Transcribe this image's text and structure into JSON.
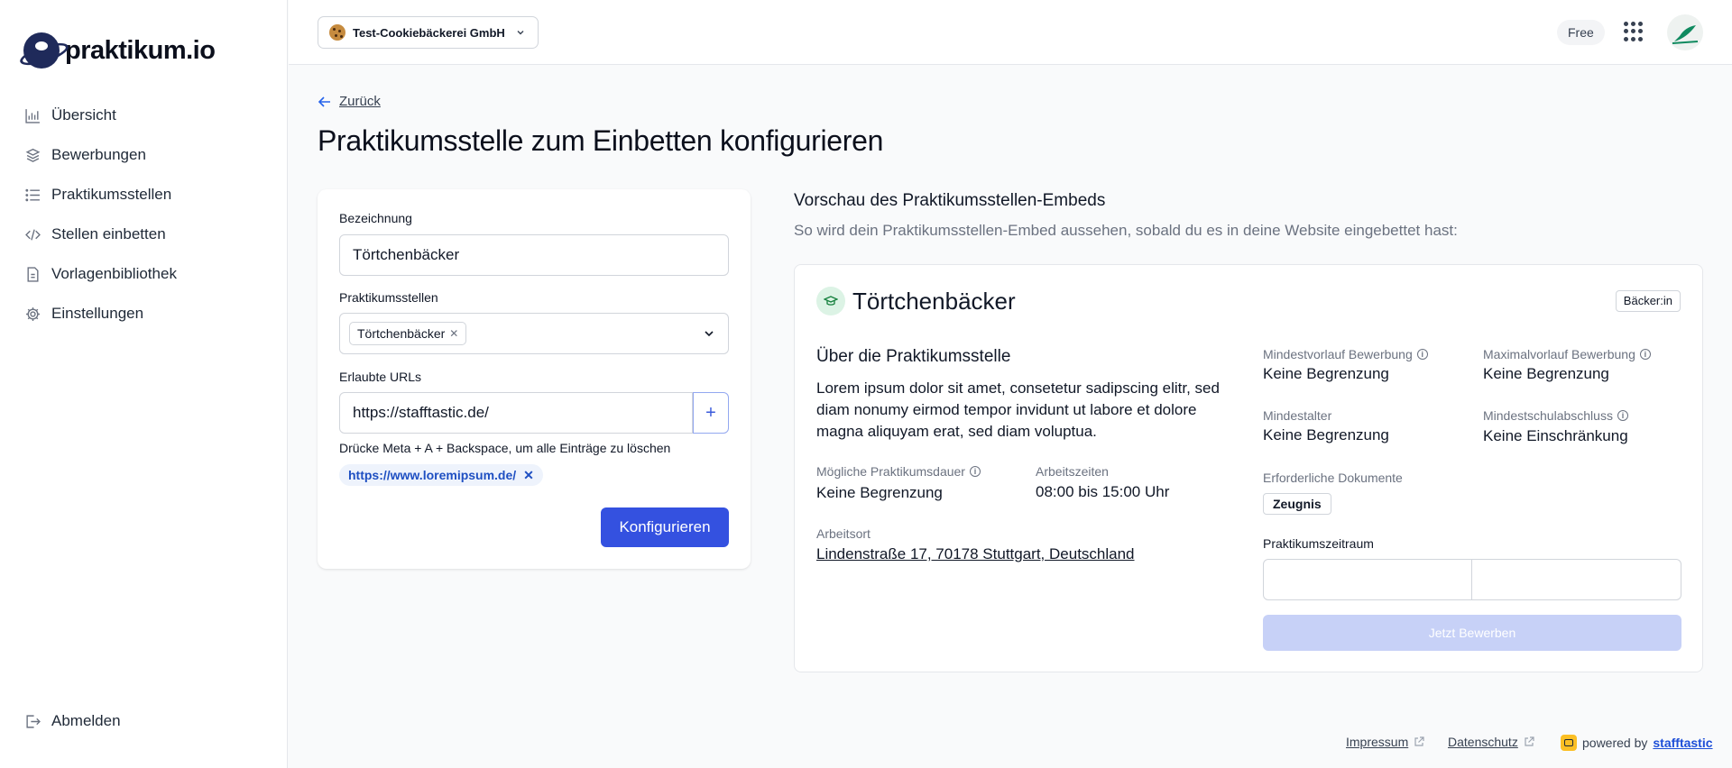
{
  "app": {
    "logo_text": "praktikum.io"
  },
  "sidebar": {
    "items": [
      {
        "label": "Übersicht",
        "icon": "bar-chart-icon"
      },
      {
        "label": "Bewerbungen",
        "icon": "layers-icon"
      },
      {
        "label": "Praktikumsstellen",
        "icon": "list-icon"
      },
      {
        "label": "Stellen einbetten",
        "icon": "code-icon"
      },
      {
        "label": "Vorlagenbibliothek",
        "icon": "file-icon"
      },
      {
        "label": "Einstellungen",
        "icon": "gear-icon"
      }
    ],
    "logout_label": "Abmelden"
  },
  "topbar": {
    "company": "Test-Cookiebäckerei GmbH",
    "plan": "Free"
  },
  "page": {
    "back_label": "Zurück",
    "title": "Praktikumsstelle zum Einbetten konfigurieren"
  },
  "form": {
    "name_label": "Bezeichnung",
    "name_value": "Törtchenbäcker",
    "positions_label": "Praktikumsstellen",
    "positions_selected": [
      "Törtchenbäcker"
    ],
    "urls_label": "Erlaubte URLs",
    "url_value": "https://stafftastic.de/",
    "hint": "Drücke Meta + A + Backspace, um alle Einträge zu löschen",
    "url_chips": [
      "https://www.loremipsum.de/"
    ],
    "submit_label": "Konfigurieren"
  },
  "preview": {
    "title": "Vorschau des Praktikumsstellen-Embeds",
    "subtitle": "So wird dein Praktikumsstellen-Embed aussehen, sobald du es in deine Website eingebettet hast:",
    "job_title": "Törtchenbäcker",
    "badge": "Bäcker:in",
    "section_title": "Über die Praktikumsstelle",
    "description": "Lorem ipsum dolor sit amet, consetetur sadipscing elitr, sed diam nonumy eirmod tempor invidunt ut labore et dolore magna aliquyam erat, sed diam voluptua.",
    "duration_label": "Mögliche Praktikumsdauer",
    "duration_value": "Keine Begrenzung",
    "hours_label": "Arbeitszeiten",
    "hours_value": "08:00 bis 15:00 Uhr",
    "location_label": "Arbeitsort",
    "location_value": "Lindenstraße 17, 70178 Stuttgart, Deutschland",
    "min_lead_label": "Mindestvorlauf Bewerbung",
    "min_lead_value": "Keine Begrenzung",
    "max_lead_label": "Maximalvorlauf Bewerbung",
    "max_lead_value": "Keine Begrenzung",
    "min_age_label": "Mindestalter",
    "min_age_value": "Keine Begrenzung",
    "min_school_label": "Mindestschulabschluss",
    "min_school_value": "Keine Einschränkung",
    "docs_label": "Erforderliche Dokumente",
    "docs": [
      "Zeugnis"
    ],
    "period_label": "Praktikumszeitraum",
    "apply_label": "Jetzt Bewerben"
  },
  "footer": {
    "impressum": "Impressum",
    "datenschutz": "Datenschutz",
    "powered_by": "powered by",
    "brand": "stafftastic"
  },
  "colors": {
    "primary": "#3451e0",
    "primary_disabled": "#c7d1f7",
    "chip_bg": "#eef3fc",
    "icon_green_bg": "#dcf3e5"
  }
}
